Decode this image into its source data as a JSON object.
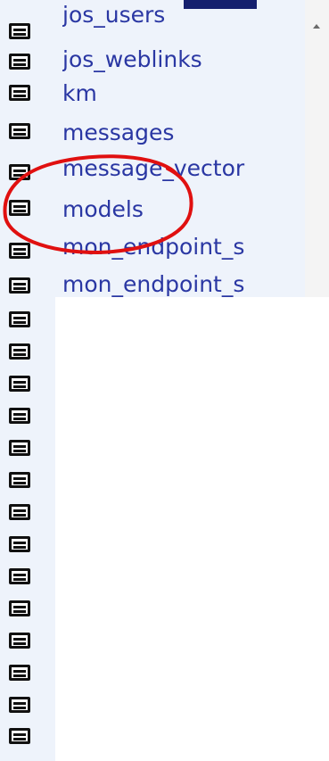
{
  "tables": [
    {
      "label": "jos_users"
    },
    {
      "label": "jos_weblinks"
    },
    {
      "label": "km"
    },
    {
      "label": "messages"
    },
    {
      "label": "message_vector"
    },
    {
      "label": "models"
    },
    {
      "label": "mon_endpoint_s"
    },
    {
      "label": "mon_endpoint_s"
    }
  ],
  "highlight": {
    "target": "models",
    "color": "#e01010"
  },
  "colors": {
    "link": "#2a37a3",
    "panel_bg": "#eef3fb",
    "selection": "#15206e"
  }
}
